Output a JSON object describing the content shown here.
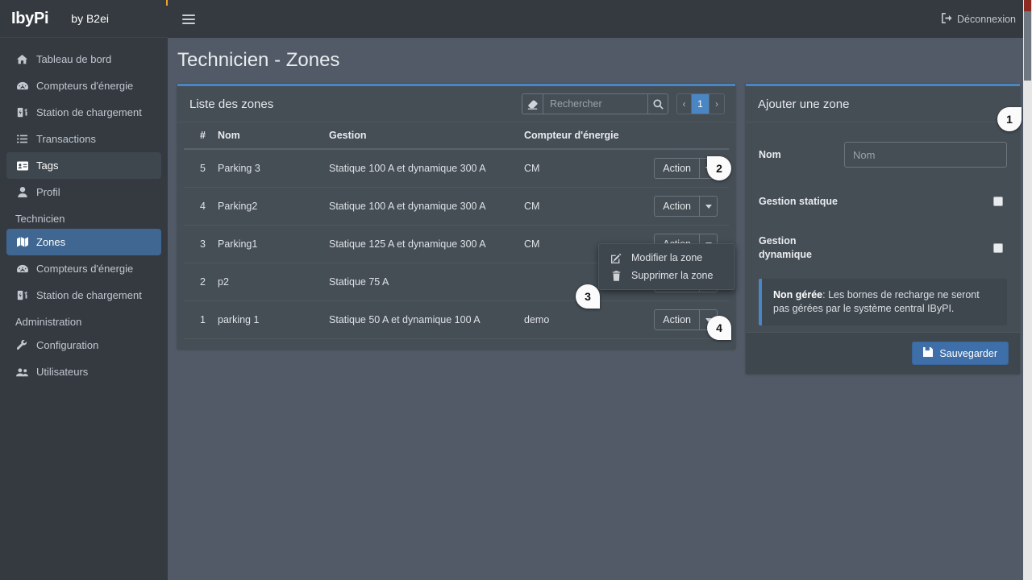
{
  "brand": {
    "logo_text": "IbyPi",
    "suffix": "by B2ei"
  },
  "topbar": {
    "menu_icon": "hamburger-icon",
    "logout_label": "Déconnexion",
    "logout_icon": "sign-out-icon"
  },
  "page": {
    "title": "Technicien - Zones"
  },
  "sidebar": {
    "items": [
      {
        "label": "Tableau de bord",
        "icon": "home-icon",
        "state": "normal"
      },
      {
        "label": "Compteurs d'énergie",
        "icon": "gauge-icon",
        "state": "normal"
      },
      {
        "label": "Station de chargement",
        "icon": "charging-station-icon",
        "state": "normal"
      },
      {
        "label": "Transactions",
        "icon": "list-icon",
        "state": "normal"
      },
      {
        "label": "Tags",
        "icon": "id-card-icon",
        "state": "hover"
      },
      {
        "label": "Profil",
        "icon": "user-icon",
        "state": "normal"
      }
    ],
    "section_technicien": "Technicien",
    "technicien_items": [
      {
        "label": "Zones",
        "icon": "map-icon",
        "state": "active"
      },
      {
        "label": "Compteurs d'énergie",
        "icon": "gauge-icon",
        "state": "normal"
      },
      {
        "label": "Station de chargement",
        "icon": "charging-station-icon",
        "state": "normal"
      }
    ],
    "section_administration": "Administration",
    "administration_items": [
      {
        "label": "Configuration",
        "icon": "wrench-icon",
        "state": "normal"
      },
      {
        "label": "Utilisateurs",
        "icon": "users-icon",
        "state": "normal"
      }
    ]
  },
  "zones_card": {
    "title": "Liste des zones",
    "eraser_icon": "eraser-icon",
    "search": {
      "placeholder": "Rechercher",
      "value": ""
    },
    "search_icon": "search-icon",
    "pagination": {
      "prev": "‹",
      "current": "1",
      "next": "›"
    },
    "columns": [
      "#",
      "Nom",
      "Gestion",
      "Compteur d'énergie",
      ""
    ],
    "action_label": "Action",
    "rows": [
      {
        "id": "5",
        "nom": "Parking 3",
        "gestion": "Statique 100 A et dynamique 300 A",
        "compteur": "CM"
      },
      {
        "id": "4",
        "nom": "Parking2",
        "gestion": "Statique 100 A et dynamique 300 A",
        "compteur": "CM"
      },
      {
        "id": "3",
        "nom": "Parking1",
        "gestion": "Statique 125 A et dynamique 300 A",
        "compteur": "CM"
      },
      {
        "id": "2",
        "nom": "p2",
        "gestion": "Statique 75 A",
        "compteur": ""
      },
      {
        "id": "1",
        "nom": "parking 1",
        "gestion": "Statique 50 A et dynamique 100 A",
        "compteur": "demo"
      }
    ]
  },
  "dropdown": {
    "items": [
      {
        "label": "Modifier la zone",
        "icon": "edit-icon"
      },
      {
        "label": "Supprimer la zone",
        "icon": "trash-icon"
      }
    ]
  },
  "add_zone_card": {
    "title": "Ajouter une zone",
    "nom_label": "Nom",
    "nom_placeholder": "Nom",
    "nom_value": "",
    "gestion_statique_label": "Gestion statique",
    "gestion_statique_checked": false,
    "gestion_dynamique_label": "Gestion dynamique",
    "gestion_dynamique_checked": false,
    "alert_strong": "Non gérée",
    "alert_text": ": Les bornes de recharge ne seront pas gérées par le système central IByPI.",
    "save_label": "Sauvegarder",
    "save_icon": "save-icon"
  },
  "markers": {
    "m1": "1",
    "m2": "2",
    "m3": "3",
    "m4": "4"
  },
  "colors": {
    "sidebar_bg": "#343a40",
    "card_bg": "#454d55",
    "page_bg": "#515a66",
    "accent": "#4b86c4",
    "active_nav": "#3f6791",
    "primary_button": "#3f6fa8",
    "logo_blue": "#2f8ee0",
    "logo_orange": "#f0a427"
  }
}
